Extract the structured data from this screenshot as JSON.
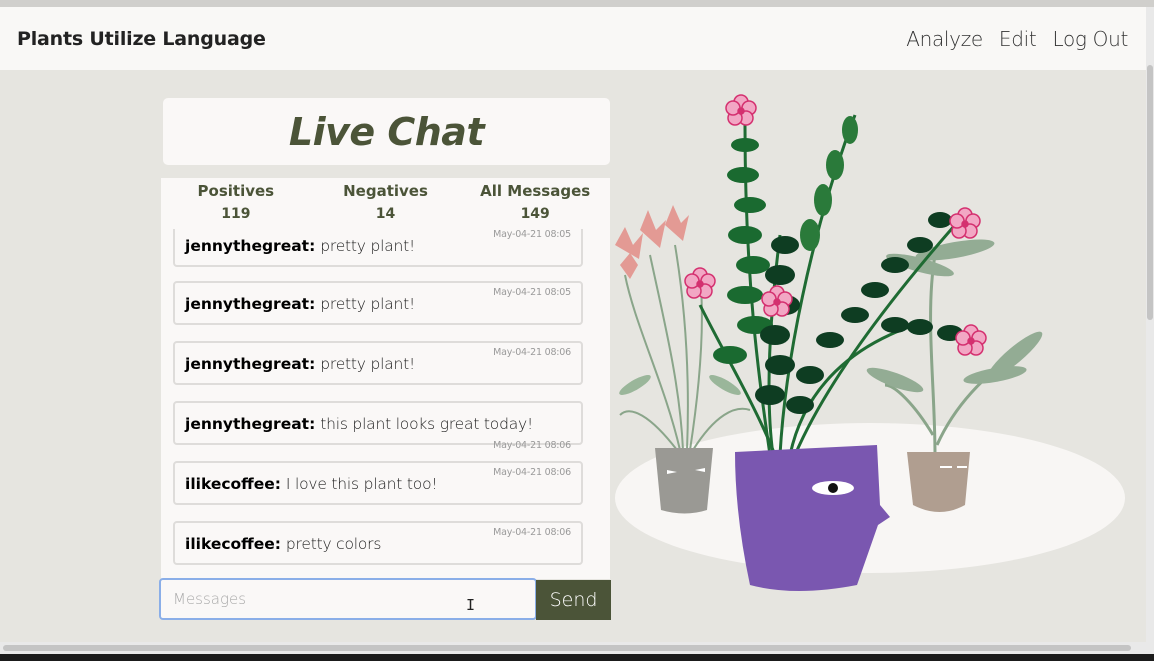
{
  "navbar": {
    "brand": "Plants Utilize Language",
    "links": [
      "Analyze",
      "Edit",
      "Log Out"
    ]
  },
  "chat": {
    "title": "Live Chat",
    "stats": [
      {
        "label": "Positives",
        "value": "119"
      },
      {
        "label": "Negatives",
        "value": "14"
      },
      {
        "label": "All Messages",
        "value": "149"
      }
    ],
    "messages": [
      {
        "author": "jennythegreat:",
        "text": "pretty plant!",
        "time": "May-04-21 08:05"
      },
      {
        "author": "jennythegreat:",
        "text": "pretty plant!",
        "time": "May-04-21 08:05"
      },
      {
        "author": "jennythegreat:",
        "text": "pretty plant!",
        "time": "May-04-21 08:06"
      },
      {
        "author": "jennythegreat:",
        "text": "this plant looks great today!",
        "time": "May-04-21 08:06"
      },
      {
        "author": "ilikecoffee:",
        "text": "I love this plant too!",
        "time": "May-04-21 08:06"
      },
      {
        "author": "ilikecoffee:",
        "text": "pretty colors",
        "time": "May-04-21 08:06"
      }
    ],
    "input": {
      "value": "",
      "placeholder": "Messages"
    },
    "send_label": "Send"
  },
  "colors": {
    "accent": "#4b5438",
    "background": "#e6e5e0",
    "card": "#faf8f7",
    "input_focus": "#8aaee8",
    "pot_main": "#7a57b0",
    "flower_pink": "#e0468a"
  },
  "icons": [
    "text-cursor-icon"
  ],
  "illustration": {
    "description_name": "plant-illustration"
  }
}
